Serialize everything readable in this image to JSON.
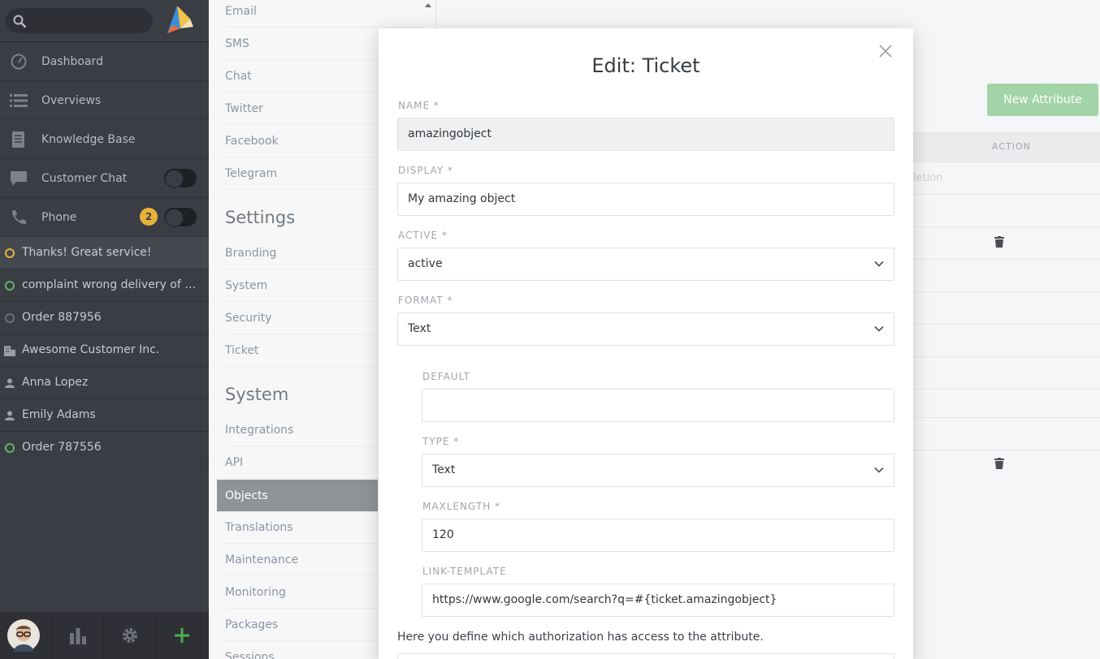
{
  "nav": {
    "search_placeholder": "",
    "items": [
      {
        "label": "Dashboard",
        "icon": "dashboard-icon"
      },
      {
        "label": "Overviews",
        "icon": "list-icon"
      },
      {
        "label": "Knowledge Base",
        "icon": "book-icon"
      },
      {
        "label": "Customer Chat",
        "icon": "chat-icon"
      },
      {
        "label": "Phone",
        "icon": "phone-icon",
        "badge": "2"
      }
    ],
    "tasks": [
      {
        "label": "Thanks! Great service!",
        "icon": "ticket-open-icon",
        "color": "#e8b23a"
      },
      {
        "label": "complaint wrong delivery of ord...",
        "icon": "ticket-open-icon",
        "color": "#5fb36a"
      },
      {
        "label": "Order 887956",
        "icon": "ticket-closed-icon",
        "color": "#6d7076"
      },
      {
        "label": "Awesome Customer Inc.",
        "icon": "organization-icon",
        "color": "#9aa0a8"
      },
      {
        "label": "Anna Lopez",
        "icon": "user-icon",
        "color": "#9aa0a8"
      },
      {
        "label": "Emily Adams",
        "icon": "user-icon",
        "color": "#9aa0a8"
      },
      {
        "label": "Order 787556",
        "icon": "ticket-open-icon",
        "color": "#5fb36a"
      }
    ]
  },
  "settings_nav": {
    "channels": [
      "Email",
      "SMS",
      "Chat",
      "Twitter",
      "Facebook",
      "Telegram"
    ],
    "settings_heading": "Settings",
    "settings_items": [
      "Branding",
      "System",
      "Security",
      "Ticket"
    ],
    "system_heading": "System",
    "system_items": [
      "Integrations",
      "API",
      "Objects",
      "Translations",
      "Maintenance",
      "Monitoring",
      "Packages",
      "Sessions"
    ]
  },
  "content": {
    "new_attribute": "New Attribute",
    "action_header": "ACTION",
    "bg_fragment": "letion"
  },
  "modal": {
    "title": "Edit: Ticket",
    "name_label": "NAME *",
    "name_value": "amazingobject",
    "display_label": "DISPLAY *",
    "display_value": "My amazing object",
    "active_label": "ACTIVE *",
    "active_value": "active",
    "format_label": "FORMAT *",
    "format_value": "Text",
    "default_label": "DEFAULT",
    "default_value": "",
    "type_label": "TYPE *",
    "type_value": "Text",
    "maxlength_label": "MAXLENGTH *",
    "maxlength_value": "120",
    "link_label": "LINK-TEMPLATE",
    "link_value": "https://www.google.com/search?q=#{ticket.amazingobject}",
    "note": "Here you define which authorization has access to the attribute."
  }
}
